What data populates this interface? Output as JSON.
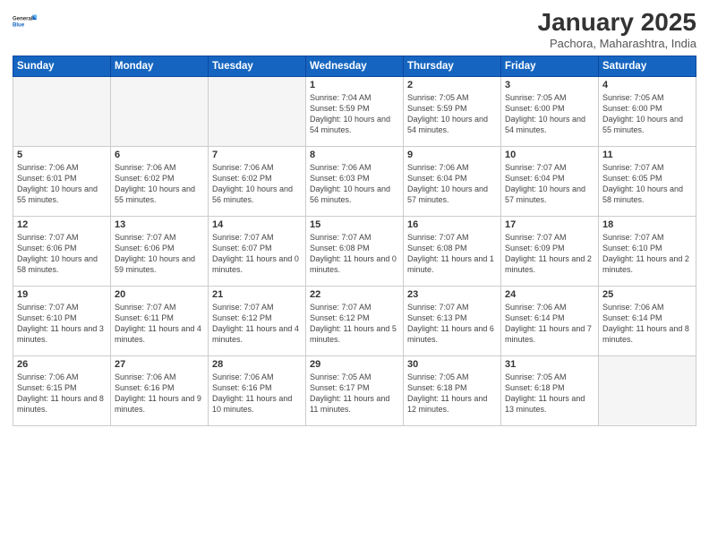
{
  "header": {
    "logo_line1": "General",
    "logo_line2": "Blue",
    "month_year": "January 2025",
    "location": "Pachora, Maharashtra, India"
  },
  "weekdays": [
    "Sunday",
    "Monday",
    "Tuesday",
    "Wednesday",
    "Thursday",
    "Friday",
    "Saturday"
  ],
  "weeks": [
    [
      {
        "day": "",
        "info": ""
      },
      {
        "day": "",
        "info": ""
      },
      {
        "day": "",
        "info": ""
      },
      {
        "day": "1",
        "info": "Sunrise: 7:04 AM\nSunset: 5:59 PM\nDaylight: 10 hours and 54 minutes."
      },
      {
        "day": "2",
        "info": "Sunrise: 7:05 AM\nSunset: 5:59 PM\nDaylight: 10 hours and 54 minutes."
      },
      {
        "day": "3",
        "info": "Sunrise: 7:05 AM\nSunset: 6:00 PM\nDaylight: 10 hours and 54 minutes."
      },
      {
        "day": "4",
        "info": "Sunrise: 7:05 AM\nSunset: 6:00 PM\nDaylight: 10 hours and 55 minutes."
      }
    ],
    [
      {
        "day": "5",
        "info": "Sunrise: 7:06 AM\nSunset: 6:01 PM\nDaylight: 10 hours and 55 minutes."
      },
      {
        "day": "6",
        "info": "Sunrise: 7:06 AM\nSunset: 6:02 PM\nDaylight: 10 hours and 55 minutes."
      },
      {
        "day": "7",
        "info": "Sunrise: 7:06 AM\nSunset: 6:02 PM\nDaylight: 10 hours and 56 minutes."
      },
      {
        "day": "8",
        "info": "Sunrise: 7:06 AM\nSunset: 6:03 PM\nDaylight: 10 hours and 56 minutes."
      },
      {
        "day": "9",
        "info": "Sunrise: 7:06 AM\nSunset: 6:04 PM\nDaylight: 10 hours and 57 minutes."
      },
      {
        "day": "10",
        "info": "Sunrise: 7:07 AM\nSunset: 6:04 PM\nDaylight: 10 hours and 57 minutes."
      },
      {
        "day": "11",
        "info": "Sunrise: 7:07 AM\nSunset: 6:05 PM\nDaylight: 10 hours and 58 minutes."
      }
    ],
    [
      {
        "day": "12",
        "info": "Sunrise: 7:07 AM\nSunset: 6:06 PM\nDaylight: 10 hours and 58 minutes."
      },
      {
        "day": "13",
        "info": "Sunrise: 7:07 AM\nSunset: 6:06 PM\nDaylight: 10 hours and 59 minutes."
      },
      {
        "day": "14",
        "info": "Sunrise: 7:07 AM\nSunset: 6:07 PM\nDaylight: 11 hours and 0 minutes."
      },
      {
        "day": "15",
        "info": "Sunrise: 7:07 AM\nSunset: 6:08 PM\nDaylight: 11 hours and 0 minutes."
      },
      {
        "day": "16",
        "info": "Sunrise: 7:07 AM\nSunset: 6:08 PM\nDaylight: 11 hours and 1 minute."
      },
      {
        "day": "17",
        "info": "Sunrise: 7:07 AM\nSunset: 6:09 PM\nDaylight: 11 hours and 2 minutes."
      },
      {
        "day": "18",
        "info": "Sunrise: 7:07 AM\nSunset: 6:10 PM\nDaylight: 11 hours and 2 minutes."
      }
    ],
    [
      {
        "day": "19",
        "info": "Sunrise: 7:07 AM\nSunset: 6:10 PM\nDaylight: 11 hours and 3 minutes."
      },
      {
        "day": "20",
        "info": "Sunrise: 7:07 AM\nSunset: 6:11 PM\nDaylight: 11 hours and 4 minutes."
      },
      {
        "day": "21",
        "info": "Sunrise: 7:07 AM\nSunset: 6:12 PM\nDaylight: 11 hours and 4 minutes."
      },
      {
        "day": "22",
        "info": "Sunrise: 7:07 AM\nSunset: 6:12 PM\nDaylight: 11 hours and 5 minutes."
      },
      {
        "day": "23",
        "info": "Sunrise: 7:07 AM\nSunset: 6:13 PM\nDaylight: 11 hours and 6 minutes."
      },
      {
        "day": "24",
        "info": "Sunrise: 7:06 AM\nSunset: 6:14 PM\nDaylight: 11 hours and 7 minutes."
      },
      {
        "day": "25",
        "info": "Sunrise: 7:06 AM\nSunset: 6:14 PM\nDaylight: 11 hours and 8 minutes."
      }
    ],
    [
      {
        "day": "26",
        "info": "Sunrise: 7:06 AM\nSunset: 6:15 PM\nDaylight: 11 hours and 8 minutes."
      },
      {
        "day": "27",
        "info": "Sunrise: 7:06 AM\nSunset: 6:16 PM\nDaylight: 11 hours and 9 minutes."
      },
      {
        "day": "28",
        "info": "Sunrise: 7:06 AM\nSunset: 6:16 PM\nDaylight: 11 hours and 10 minutes."
      },
      {
        "day": "29",
        "info": "Sunrise: 7:05 AM\nSunset: 6:17 PM\nDaylight: 11 hours and 11 minutes."
      },
      {
        "day": "30",
        "info": "Sunrise: 7:05 AM\nSunset: 6:18 PM\nDaylight: 11 hours and 12 minutes."
      },
      {
        "day": "31",
        "info": "Sunrise: 7:05 AM\nSunset: 6:18 PM\nDaylight: 11 hours and 13 minutes."
      },
      {
        "day": "",
        "info": ""
      }
    ]
  ]
}
